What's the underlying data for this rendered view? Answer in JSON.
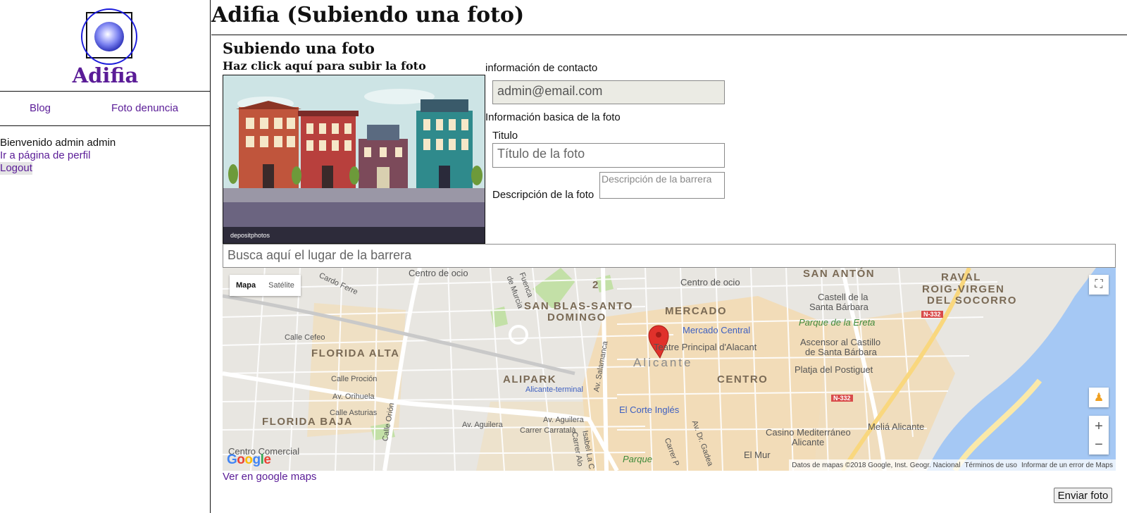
{
  "sidebar": {
    "brand": "Adifia",
    "nav": [
      {
        "label": "Blog"
      },
      {
        "label": "Foto denuncia"
      }
    ],
    "welcome": "Bienvenido admin admin",
    "profile_link": "Ir a página de perfil",
    "logout": "Logout"
  },
  "header": {
    "title": "Adifia (Subiendo una foto)"
  },
  "form": {
    "heading": "Subiendo una foto",
    "upload_hint": "Haz click aquí para subir la foto",
    "photo_watermark": "depositphotos",
    "contact_label": "información de contacto",
    "email_value": "admin@email.com",
    "basic_info_label": "Información basica de la foto",
    "title_label": "Titulo",
    "title_placeholder": "Título de la foto",
    "description_label": "Descripción de la foto",
    "description_placeholder": "Descripción de la barrera",
    "search_placeholder": "Busca aquí el lugar de la barrera",
    "maps_link": "Ver en google maps",
    "submit_label": "Enviar foto"
  },
  "map": {
    "type_buttons": {
      "map": "Mapa",
      "satellite": "Satélite"
    },
    "google_logo": "Google",
    "attribution": {
      "data": "Datos de mapas ©2018 Google, Inst. Geogr. Nacional",
      "terms": "Términos de uso",
      "report": "Informar de un error de Maps"
    },
    "labels": {
      "centro_ocio_1": "Centro de ocio",
      "centro_ocio_2": "Centro de ocio",
      "san_anton": "SAN ANTÓN",
      "raval": "RAVAL",
      "roig": "ROIG-VIRGEN",
      "socorro": "DEL SOCORRO",
      "castell": "Castell de la",
      "santa_barbara": "Santa Bárbara",
      "parque_ereta": "Parque de la Ereta",
      "san_blas": "SAN BLAS-SANTO",
      "domingo": "DOMINGO",
      "mercado": "MERCADO",
      "mercado_central": "Mercado Central",
      "teatro": "Teatre Principal d'Alacant",
      "ascensor": "Ascensor al Castillo",
      "ascensor2": "de Santa Bárbara",
      "alicante": "Alicante",
      "postiguet": "Platja del Postiguet",
      "florida_alta": "FLORIDA ALTA",
      "alipark": "ALIPARK",
      "centro": "CENTRO",
      "terminal": "Alicante-terminal",
      "corte_ingles": "El Corte Inglés",
      "florida_baja": "FLORIDA BAJA",
      "casino": "Casino Mediterráneo",
      "casino2": "Alicante",
      "melia": "Meliá Alicante",
      "calle_cefeo": "Calle Cefeo",
      "calle_procion": "Calle Proción",
      "av_orihuela": "Av. Orihuela",
      "calle_asturias": "Calle Asturias",
      "av_aguilera_1": "Av. Aguilera",
      "av_aguilera_2": "Av. Aguilera",
      "carrer_carratala": "Carrer Carratalà",
      "av_salamanca": "Av. Salamanca",
      "av_gadea": "Av. Dr. Gadea",
      "calle_orion": "Calle Orión",
      "comercial": "Centro Comercial",
      "el_mur": "El Mur",
      "parque": "Parque",
      "n332_1": "N-332",
      "n332_2": "N-332",
      "num_2": "2",
      "cardo_ferre": "Cardo Ferre",
      "fuenca": "Fuenca",
      "murcia": "de Murcia",
      "carrer_p": "Carrer P",
      "isabel": "Isabel La C",
      "carrer_alo": "Carrer Alo"
    }
  }
}
